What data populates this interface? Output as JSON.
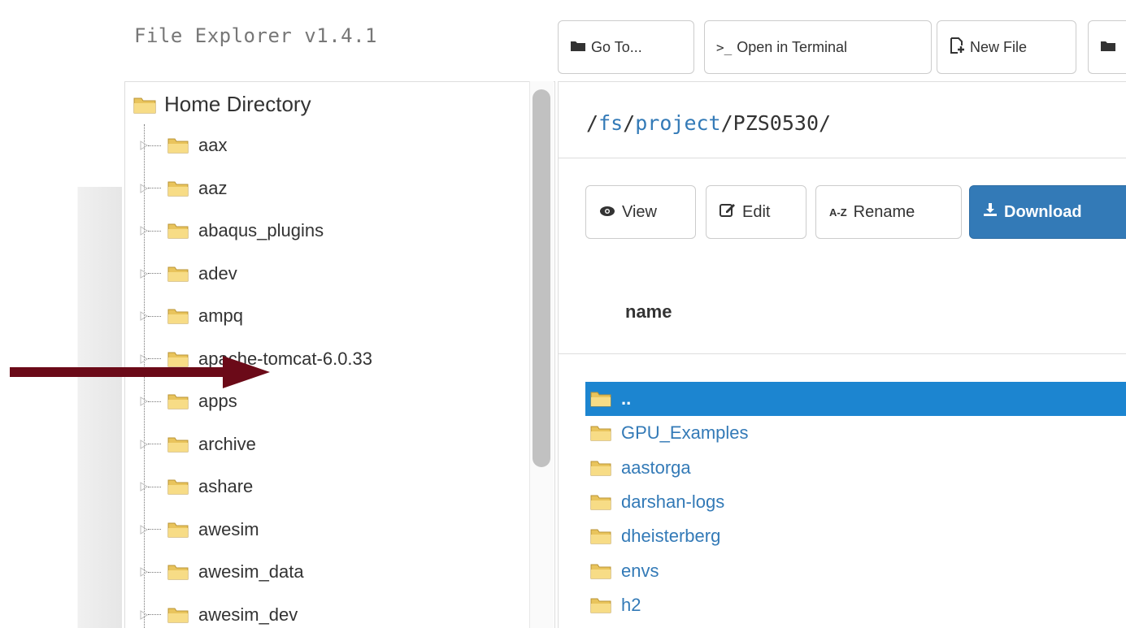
{
  "app": {
    "title": "File Explorer v1.4.1"
  },
  "toolbar": {
    "buttons": [
      {
        "label": "Go To...",
        "icon": "folder-open-icon"
      },
      {
        "label": "Open in Terminal",
        "icon": "terminal-icon"
      },
      {
        "label": "New File",
        "icon": "new-file-icon"
      }
    ]
  },
  "tree": {
    "root_label": "Home Directory",
    "items": [
      "aax",
      "aaz",
      "abaqus_plugins",
      "adev",
      "ampq",
      "apache-tomcat-6.0.33",
      "apps",
      "archive",
      "ashare",
      "awesim",
      "awesim_data",
      "awesim_dev"
    ]
  },
  "path": {
    "segments": [
      "fs",
      "project",
      "PZS0530"
    ],
    "separator": "/"
  },
  "actions": {
    "view_label": "View",
    "edit_label": "Edit",
    "rename_label": "Rename",
    "rename_icon_text": "A-Z",
    "download_label": "Download"
  },
  "table": {
    "column_name": "name"
  },
  "files": [
    {
      "name": "..",
      "selected": true
    },
    {
      "name": "GPU_Examples",
      "selected": false
    },
    {
      "name": "aastorga",
      "selected": false
    },
    {
      "name": "darshan-logs",
      "selected": false
    },
    {
      "name": "dheisterberg",
      "selected": false
    },
    {
      "name": "envs",
      "selected": false
    },
    {
      "name": "h2",
      "selected": false
    }
  ],
  "colors": {
    "accent": "#337ab7",
    "selection": "#1c85d0",
    "arrow": "#6b0a18",
    "folder": "#f5d76e"
  }
}
